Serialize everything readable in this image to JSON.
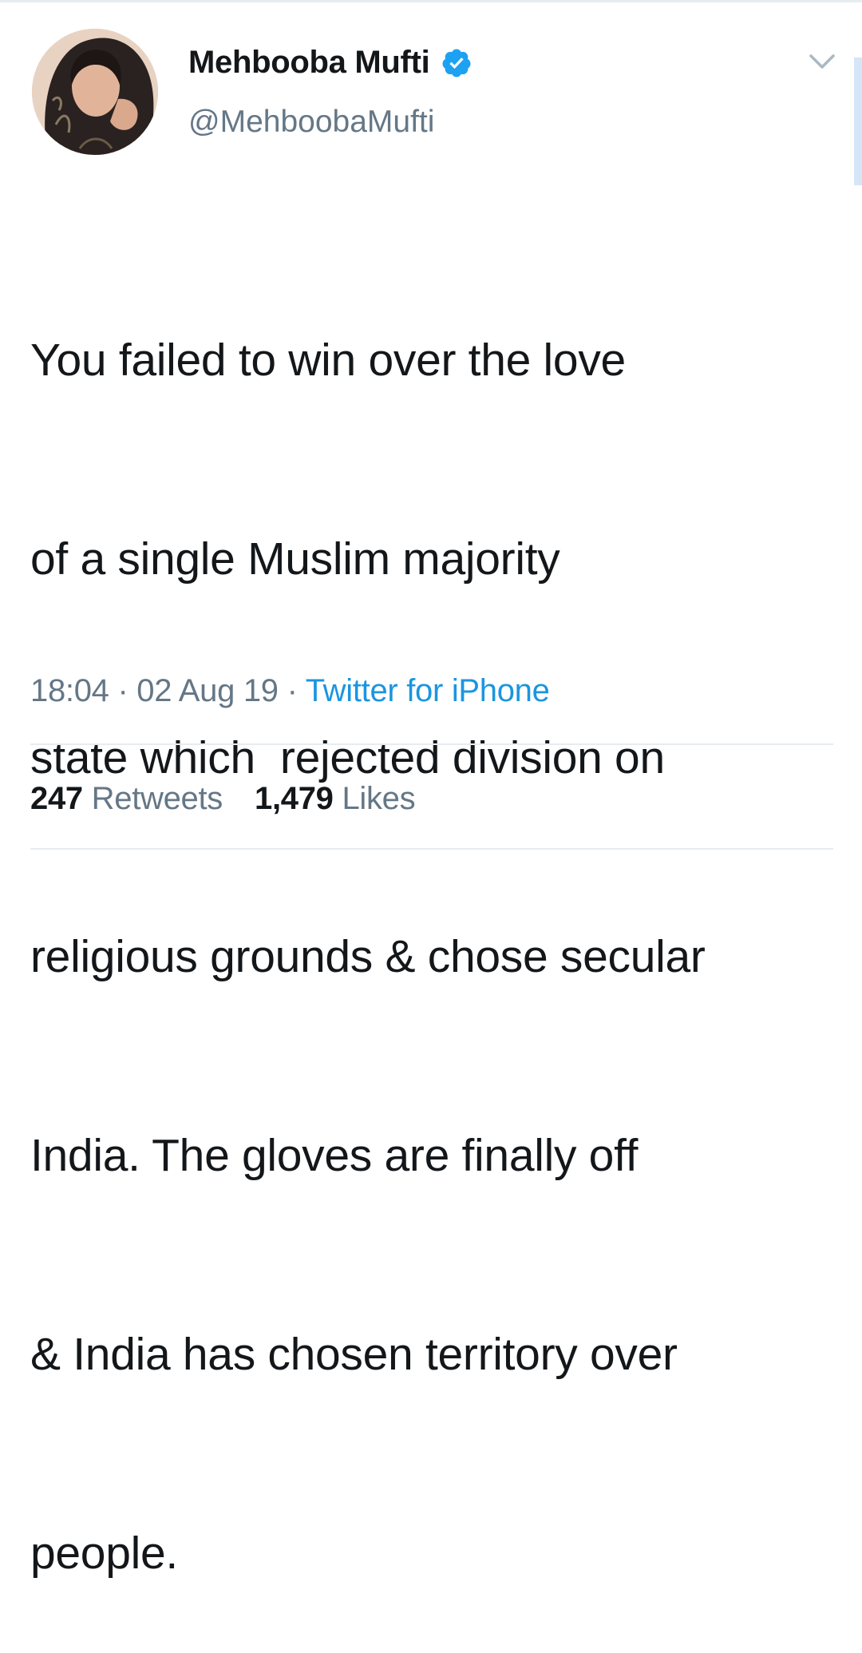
{
  "user": {
    "display_name": "Mehbooba Mufti",
    "handle": "@MehboobaMufti",
    "verified": true,
    "avatar_icon": "profile-photo"
  },
  "tweet": {
    "lines": [
      "You failed to win over the love",
      "of a single Muslim majority",
      "state which  rejected division on",
      "religious grounds & chose secular",
      "India. The gloves are finally off",
      "& India has chosen territory over",
      "people."
    ]
  },
  "meta": {
    "time": "18:04",
    "separator": "·",
    "date": "02 Aug 19",
    "source": "Twitter for iPhone"
  },
  "stats": {
    "retweets_count": "247",
    "retweets_label": "Retweets",
    "likes_count": "1,479",
    "likes_label": "Likes"
  },
  "colors": {
    "text": "#14171a",
    "secondary": "#657786",
    "accent": "#1b95e0",
    "divider": "#e6ecf0"
  },
  "icons": {
    "verified": "verified-badge-icon",
    "menu": "chevron-down-icon"
  }
}
